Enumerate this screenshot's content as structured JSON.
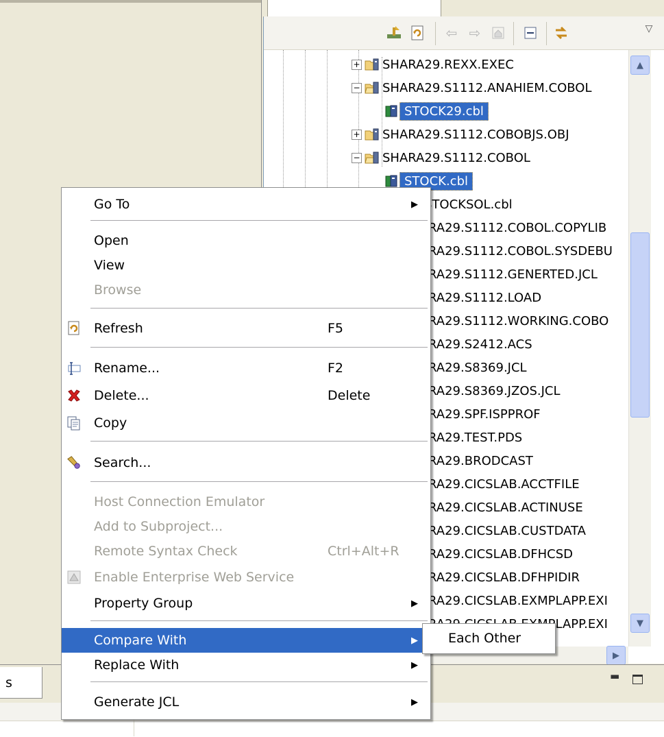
{
  "tree": {
    "rows": [
      {
        "label": "SHARA29.REXX.EXEC",
        "kind": "dataset",
        "expand": "+"
      },
      {
        "label": "SHARA29.S1112.ANAHIEM.COBOL",
        "kind": "dataset-open",
        "expand": "-"
      },
      {
        "label": "STOCK29.cbl",
        "kind": "member",
        "selected": true
      },
      {
        "label": "SHARA29.S1112.COBOBJS.OBJ",
        "kind": "dataset",
        "expand": "+"
      },
      {
        "label": "SHARA29.S1112.COBOL",
        "kind": "dataset-open",
        "expand": "-"
      },
      {
        "label": "STOCK.cbl",
        "kind": "member",
        "selected": true
      },
      {
        "label": "STOCKSOL.cbl",
        "kind": "member"
      },
      {
        "label": "RA29.S1112.COBOL.COPYLIB"
      },
      {
        "label": "RA29.S1112.COBOL.SYSDEBU"
      },
      {
        "label": "RA29.S1112.GENERTED.JCL"
      },
      {
        "label": "RA29.S1112.LOAD"
      },
      {
        "label": "RA29.S1112.WORKING.COBO"
      },
      {
        "label": "RA29.S2412.ACS"
      },
      {
        "label": "RA29.S8369.JCL"
      },
      {
        "label": "RA29.S8369.JZOS.JCL"
      },
      {
        "label": "RA29.SPF.ISPPROF"
      },
      {
        "label": "RA29.TEST.PDS"
      },
      {
        "label": "RA29.BRODCAST"
      },
      {
        "label": "RA29.CICSLAB.ACCTFILE"
      },
      {
        "label": "RA29.CICSLAB.ACTINUSE"
      },
      {
        "label": "RA29.CICSLAB.CUSTDATA"
      },
      {
        "label": "RA29.CICSLAB.DFHCSD"
      },
      {
        "label": "RA29.CICSLAB.DFHPIDIR"
      },
      {
        "label": "RA29.CICSLAB.EXMPLAPP.EXI"
      },
      {
        "label": "RA29.CICSLAB.EXMPLAPP.EXI"
      }
    ]
  },
  "context_menu": {
    "go_to": "Go To",
    "open": "Open",
    "view": "View",
    "browse": "Browse",
    "refresh": "Refresh",
    "refresh_key": "F5",
    "rename": "Rename...",
    "rename_key": "F2",
    "delete": "Delete...",
    "delete_key": "Delete",
    "copy": "Copy",
    "search": "Search...",
    "host_connection_emulator": "Host Connection Emulator",
    "add_to_subproject": "Add to Subproject...",
    "remote_syntax_check": "Remote Syntax Check",
    "remote_syntax_check_key": "Ctrl+Alt+R",
    "enable_web_service": "Enable Enterprise Web Service",
    "property_group": "Property Group",
    "compare_with": "Compare With",
    "replace_with": "Replace With",
    "generate_jcl": "Generate JCL"
  },
  "submenu": {
    "each_other": "Each Other"
  },
  "bottom_panel": {
    "tab_label": "s"
  },
  "colors": {
    "selection": "#316ac5",
    "disabled_text": "#a09f97",
    "chrome": "#ece9d8"
  }
}
